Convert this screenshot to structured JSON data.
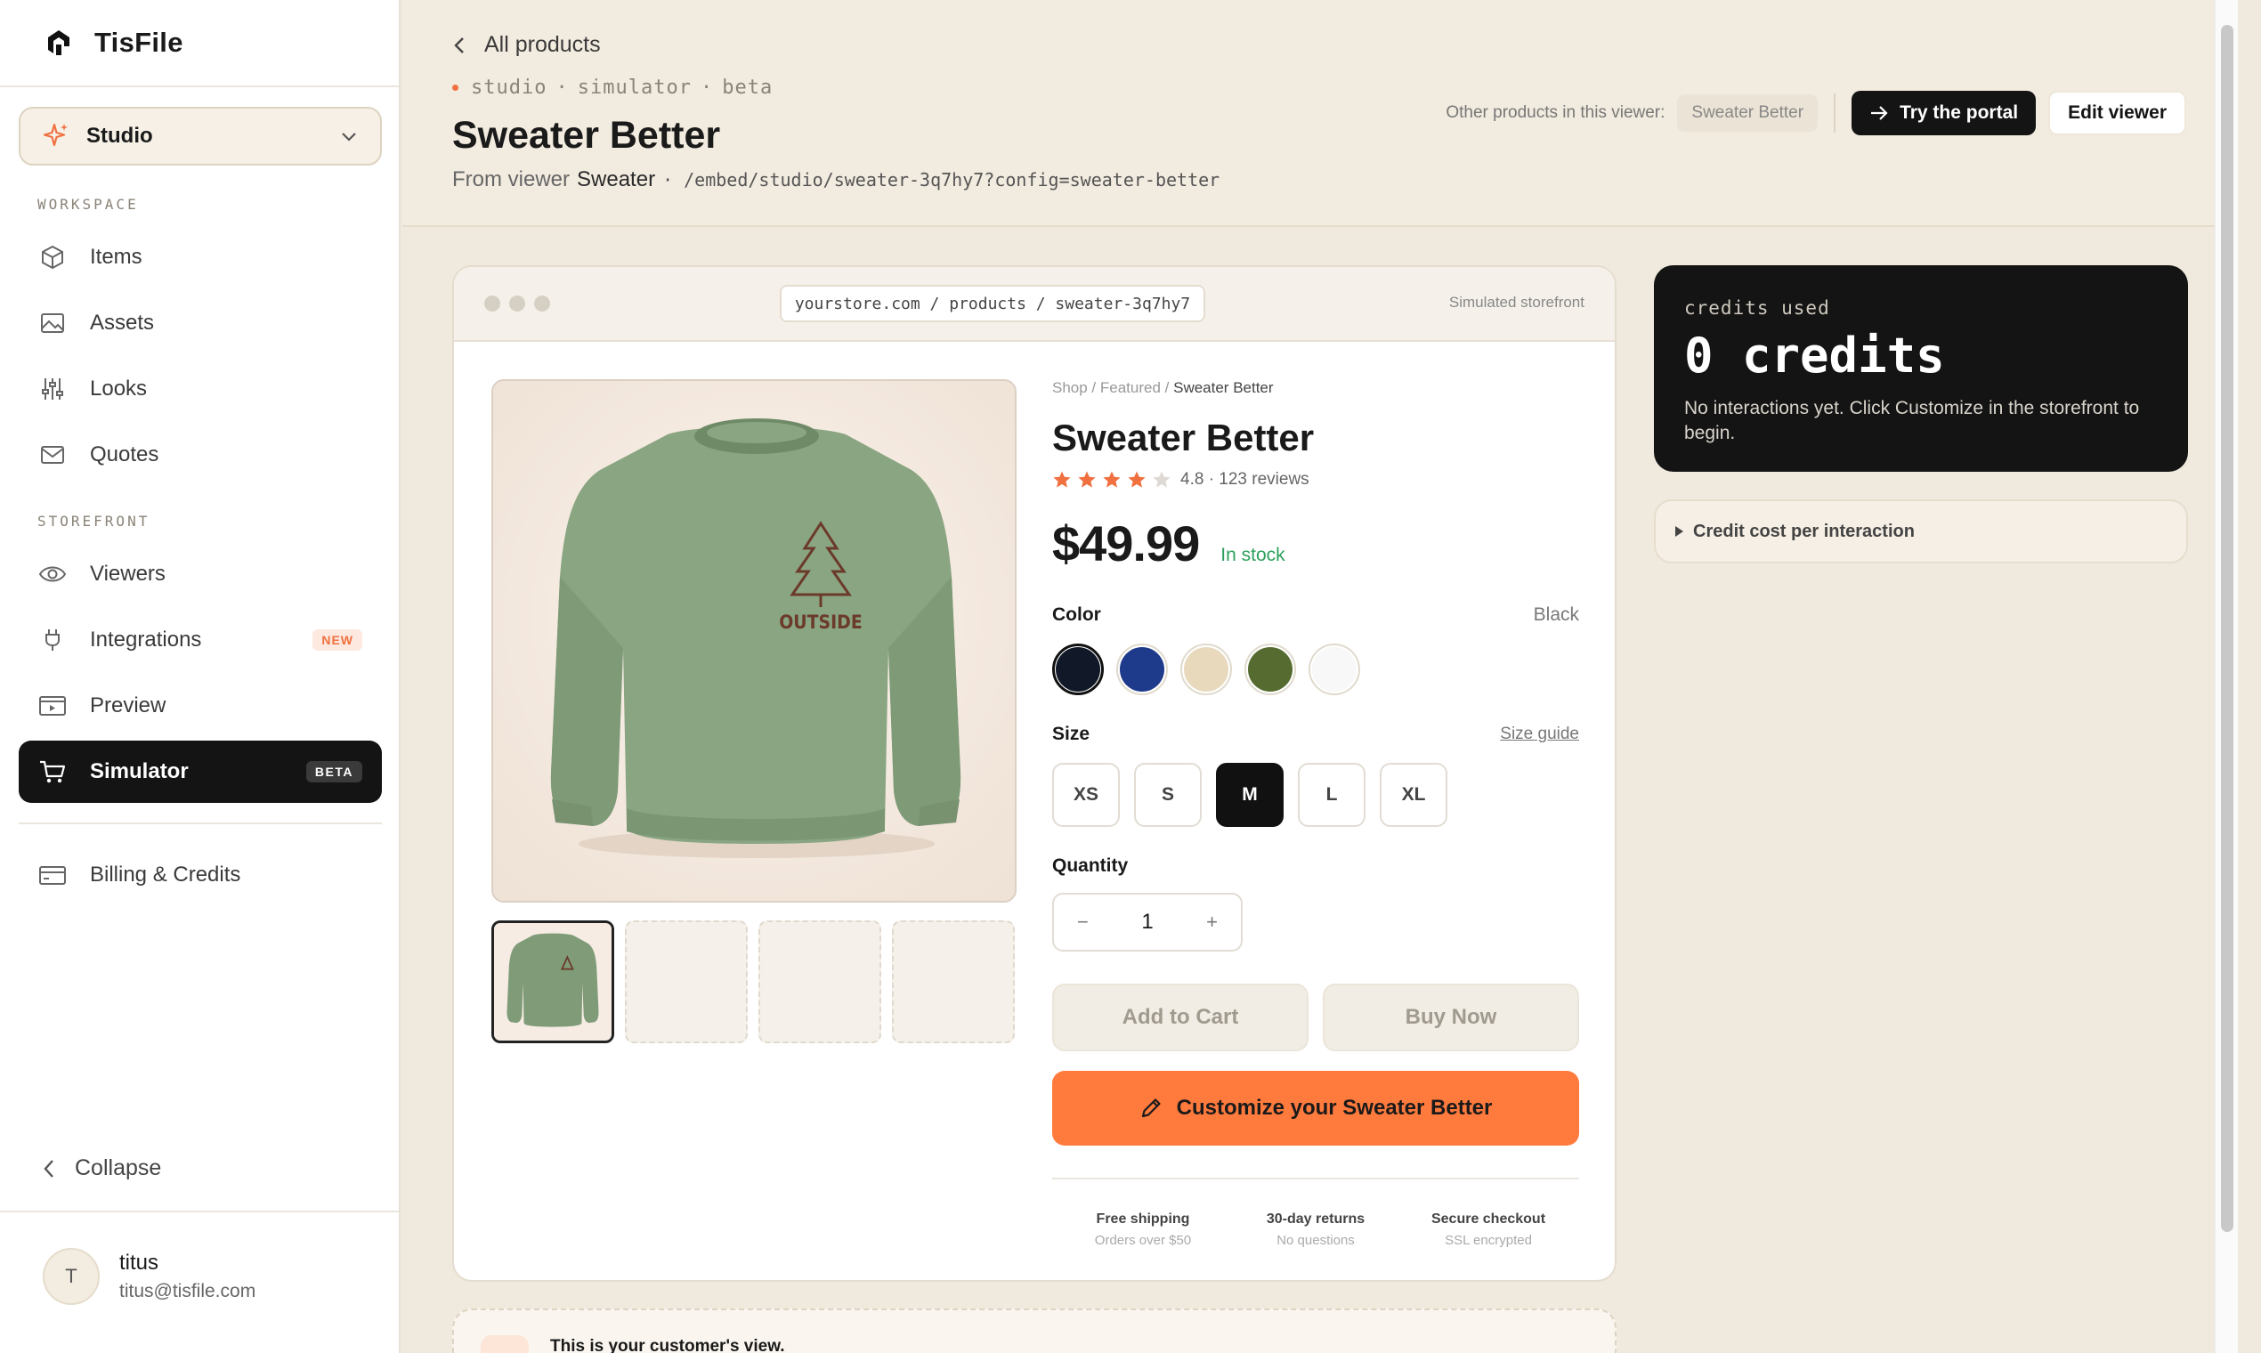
{
  "app": {
    "name": "TisFile"
  },
  "sidebar": {
    "studio_select": "Studio",
    "workspace_label": "WORKSPACE",
    "workspace_items": [
      {
        "label": "Items",
        "icon": "cube-icon"
      },
      {
        "label": "Assets",
        "icon": "image-icon"
      },
      {
        "label": "Looks",
        "icon": "sliders-icon"
      },
      {
        "label": "Quotes",
        "icon": "mail-icon"
      }
    ],
    "storefront_label": "STOREFRONT",
    "storefront_items": [
      {
        "label": "Viewers",
        "icon": "eye-icon"
      },
      {
        "label": "Integrations",
        "icon": "plug-icon",
        "badge": "NEW"
      },
      {
        "label": "Preview",
        "icon": "play-window-icon"
      },
      {
        "label": "Simulator",
        "icon": "cart-icon",
        "badge": "BETA",
        "active": true
      }
    ],
    "billing_label": "Billing & Credits",
    "collapse_label": "Collapse",
    "user": {
      "initial": "T",
      "name": "titus",
      "email": "titus@tisfile.com"
    }
  },
  "header": {
    "back_label": "All products",
    "tags": [
      "studio",
      "simulator",
      "beta"
    ],
    "tag_separator": "·",
    "title": "Sweater Better",
    "from_prefix": "From viewer",
    "viewer_name": "Sweater",
    "path": "· /embed/studio/sweater-3q7hy7?config=sweater-better",
    "other_label": "Other products in this viewer:",
    "other_chip": "Sweater Better",
    "try_portal": "Try the portal",
    "edit_viewer": "Edit viewer"
  },
  "storefront": {
    "url": "yourstore.com / products / sweater-3q7hy7",
    "simulated_label": "Simulated storefront",
    "breadcrumb_prefix": "Shop / Featured /",
    "breadcrumb_current": "Sweater Better",
    "product_title": "Sweater Better",
    "rating": 4.8,
    "rating_text": "4.8 · 123 reviews",
    "price": "$49.99",
    "stock": "In stock",
    "color_label": "Color",
    "color_value": "Black",
    "colors": [
      "#111827",
      "#1e3a8a",
      "#e8d9bd",
      "#556b2f",
      "#f8f8f8"
    ],
    "size_label": "Size",
    "size_guide": "Size guide",
    "sizes": [
      "XS",
      "S",
      "M",
      "L",
      "XL"
    ],
    "selected_size": "M",
    "quantity_label": "Quantity",
    "quantity": "1",
    "minus": "−",
    "plus": "+",
    "add_to_cart": "Add to Cart",
    "buy_now": "Buy Now",
    "customize": "Customize your Sweater Better",
    "chest_print": "OUTSIDE",
    "features": [
      {
        "title": "Free shipping",
        "sub": "Orders over $50"
      },
      {
        "title": "30-day returns",
        "sub": "No questions"
      },
      {
        "title": "Secure checkout",
        "sub": "SSL encrypted"
      }
    ],
    "customer_view": "This is your customer's view."
  },
  "credits": {
    "label": "credits used",
    "value": "0 credits",
    "desc": "No interactions yet. Click Customize in the storefront to begin."
  },
  "cost_toggle": "Credit cost per interaction",
  "colors": {
    "accent": "#ff7a3d",
    "stock": "#2ea05c",
    "dark": "#141414",
    "star": "#f07040"
  }
}
